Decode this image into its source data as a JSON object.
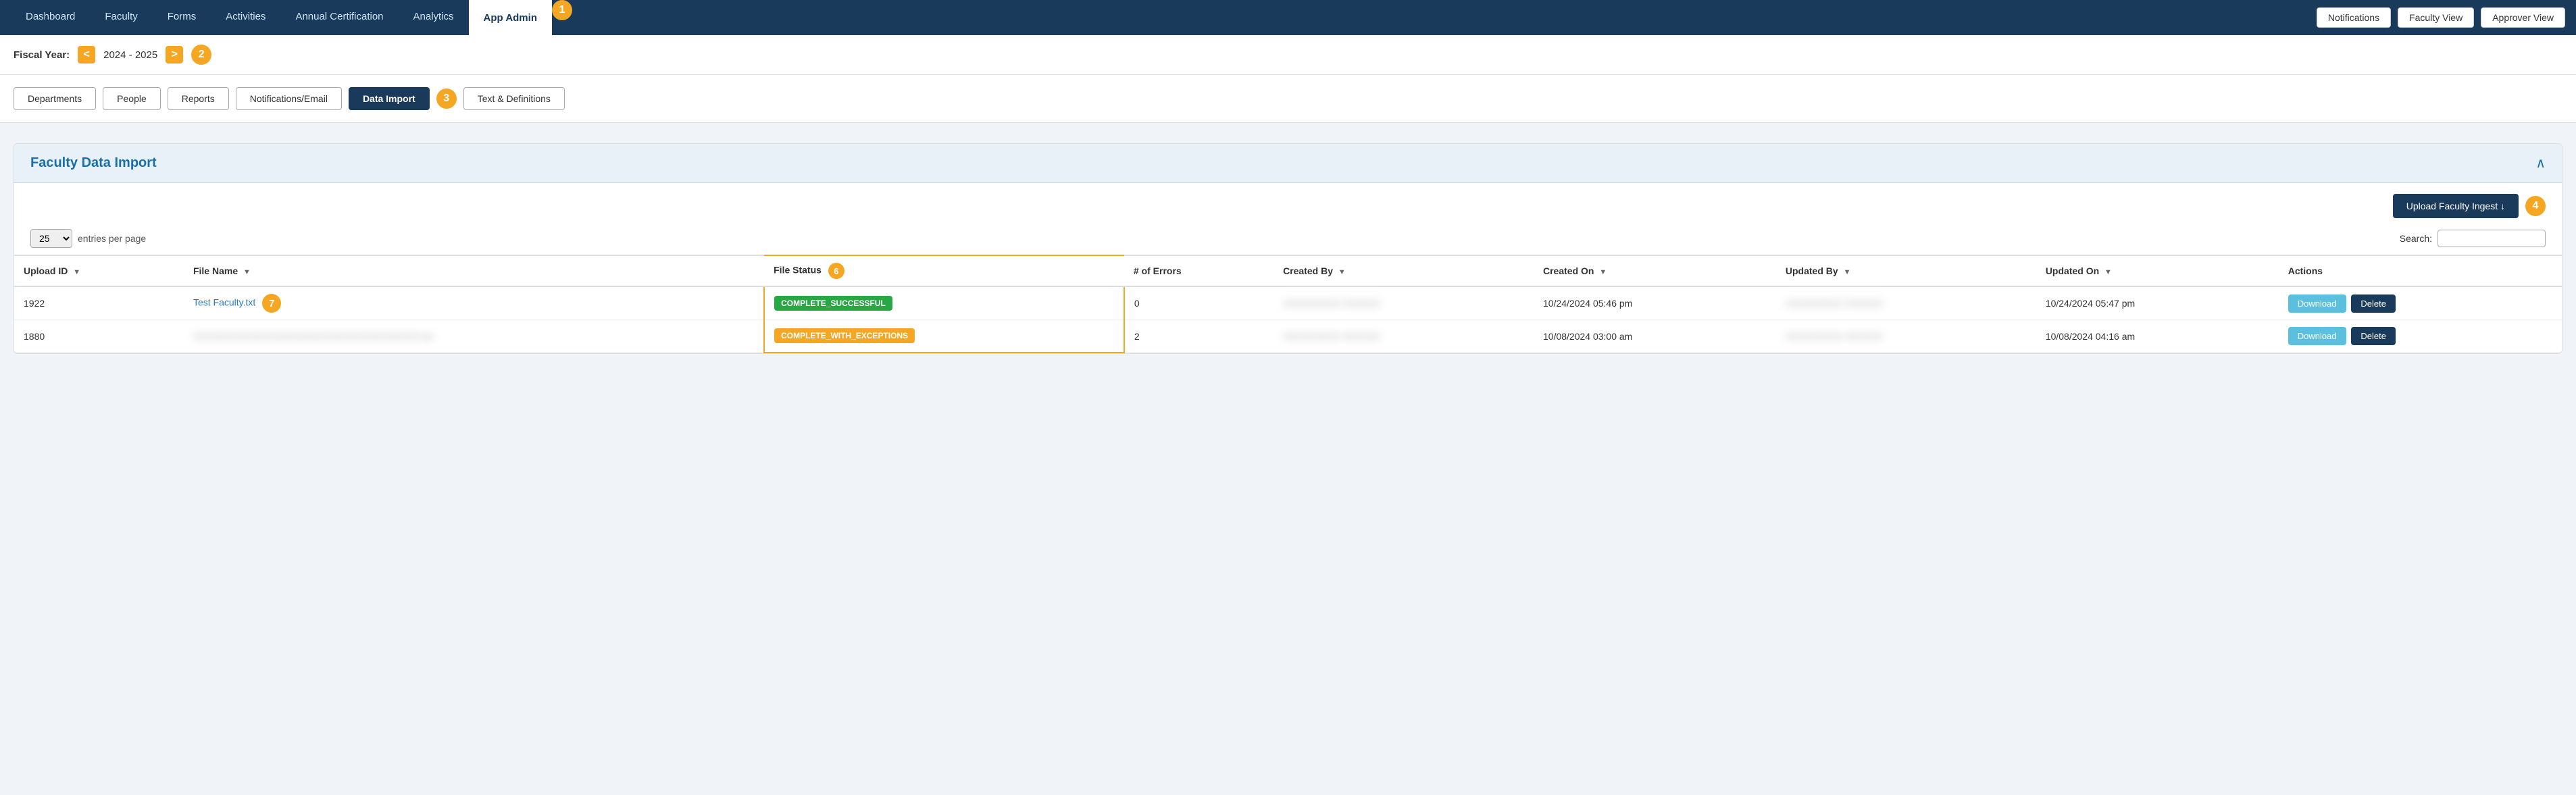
{
  "nav": {
    "items": [
      {
        "label": "Dashboard",
        "active": false
      },
      {
        "label": "Faculty",
        "active": false
      },
      {
        "label": "Forms",
        "active": false
      },
      {
        "label": "Activities",
        "active": false
      },
      {
        "label": "Annual Certification",
        "active": false
      },
      {
        "label": "Analytics",
        "active": false
      },
      {
        "label": "App Admin",
        "active": true
      }
    ],
    "badge_number": "1",
    "notifications_label": "Notifications",
    "faculty_view_label": "Faculty View",
    "approver_view_label": "Approver View"
  },
  "fiscal_year": {
    "label": "Fiscal Year:",
    "year": "2024 - 2025",
    "badge_number": "2"
  },
  "tabs": [
    {
      "label": "Departments",
      "active": false
    },
    {
      "label": "People",
      "active": false
    },
    {
      "label": "Reports",
      "active": false
    },
    {
      "label": "Notifications/Email",
      "active": false
    },
    {
      "label": "Data Import",
      "active": true
    },
    {
      "label": "Text & Definitions",
      "active": false
    }
  ],
  "tabs_badge_number": "3",
  "section": {
    "title": "Faculty Data Import",
    "upload_btn_label": "Upload Faculty Ingest ↓",
    "upload_badge_number": "4",
    "entries_per_page": "25",
    "entries_label": "entries per page",
    "search_label": "Search:",
    "search_placeholder": "",
    "file_status_badge_number": "6",
    "columns": [
      {
        "label": "Upload ID",
        "sortable": true
      },
      {
        "label": "File Name",
        "sortable": true
      },
      {
        "label": "File Status",
        "sortable": false
      },
      {
        "label": "# of Errors",
        "sortable": false
      },
      {
        "label": "Created By",
        "sortable": true
      },
      {
        "label": "Created On",
        "sortable": true
      },
      {
        "label": "Updated By",
        "sortable": true
      },
      {
        "label": "Updated On",
        "sortable": true
      },
      {
        "label": "Actions",
        "sortable": false
      }
    ],
    "rows": [
      {
        "upload_id": "1922",
        "file_name": "Test Faculty.txt",
        "file_name_is_link": true,
        "file_status": "COMPLETE_SUCCESSFUL",
        "file_status_type": "success",
        "errors": "0",
        "created_by": "XXXXXXXXX XXXXXX",
        "created_on": "10/24/2024 05:46 pm",
        "updated_by": "XXXXXXXXX XXXXXX",
        "updated_on": "10/24/2024 05:47 pm",
        "row_badge": "7"
      },
      {
        "upload_id": "1880",
        "file_name": "XXXXXXXXXXXXXXXXXXXXXXXXXXXXXXXXXXXX.txt",
        "file_name_is_link": false,
        "file_status": "COMPLETE_WITH_EXCEPTIONS",
        "file_status_type": "exception",
        "errors": "2",
        "created_by": "XXXXXXXXX XXXXXX",
        "created_on": "10/08/2024 03:00 am",
        "updated_by": "XXXXXXXXX XXXXXX",
        "updated_on": "10/08/2024 04:16 am",
        "row_badge": null
      }
    ],
    "download_label": "Download",
    "delete_label": "Delete"
  }
}
